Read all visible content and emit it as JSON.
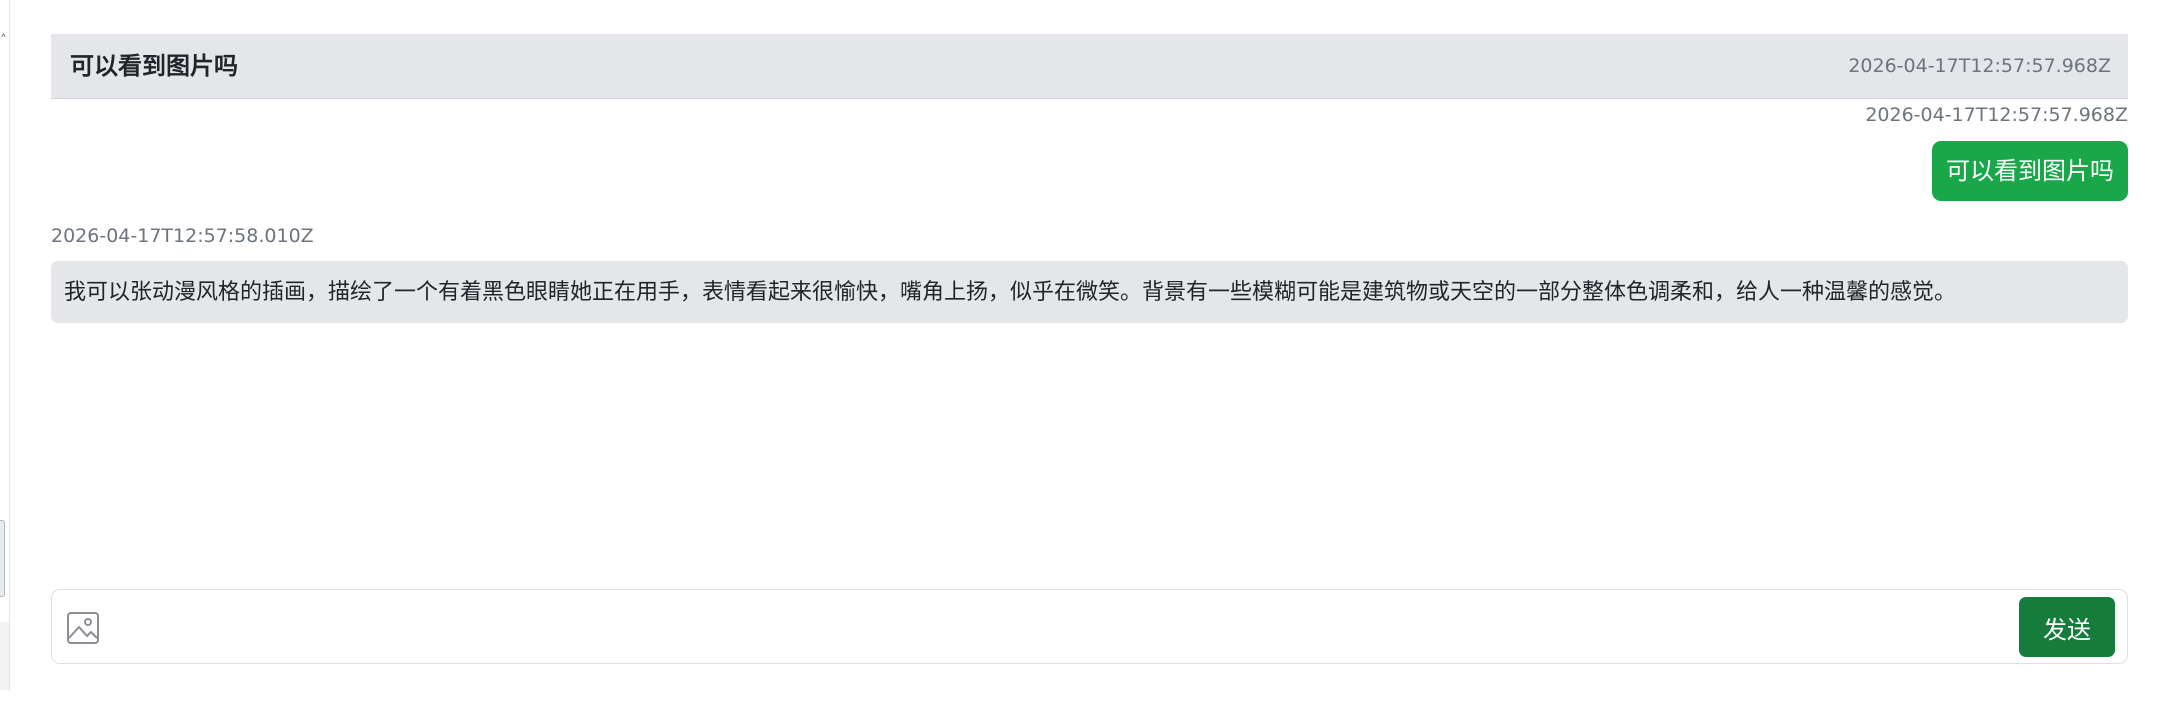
{
  "header": {
    "title": "可以看到图片吗",
    "timestamp": "2026-04-17T12:57:57.968Z"
  },
  "messages": [
    {
      "role": "user",
      "timestamp": "2026-04-17T12:57:57.968Z",
      "text": "可以看到图片吗",
      "bubble_color": "#19a74a"
    },
    {
      "role": "assistant",
      "timestamp": "2026-04-17T12:57:58.010Z",
      "text": "我可以张动漫风格的插画，描绘了一个有着黑色眼睛她正在用手，表情看起来很愉快，嘴角上扬，似乎在微笑。背景有一些模糊可能是建筑物或天空的一部分整体色调柔和，给人一种温馨的感觉。",
      "bubble_color": "#e5e6ea"
    }
  ],
  "composer": {
    "input_value": "",
    "placeholder": "",
    "image_icon": "image-icon",
    "send_label": "发送",
    "send_color": "#167c3b"
  }
}
